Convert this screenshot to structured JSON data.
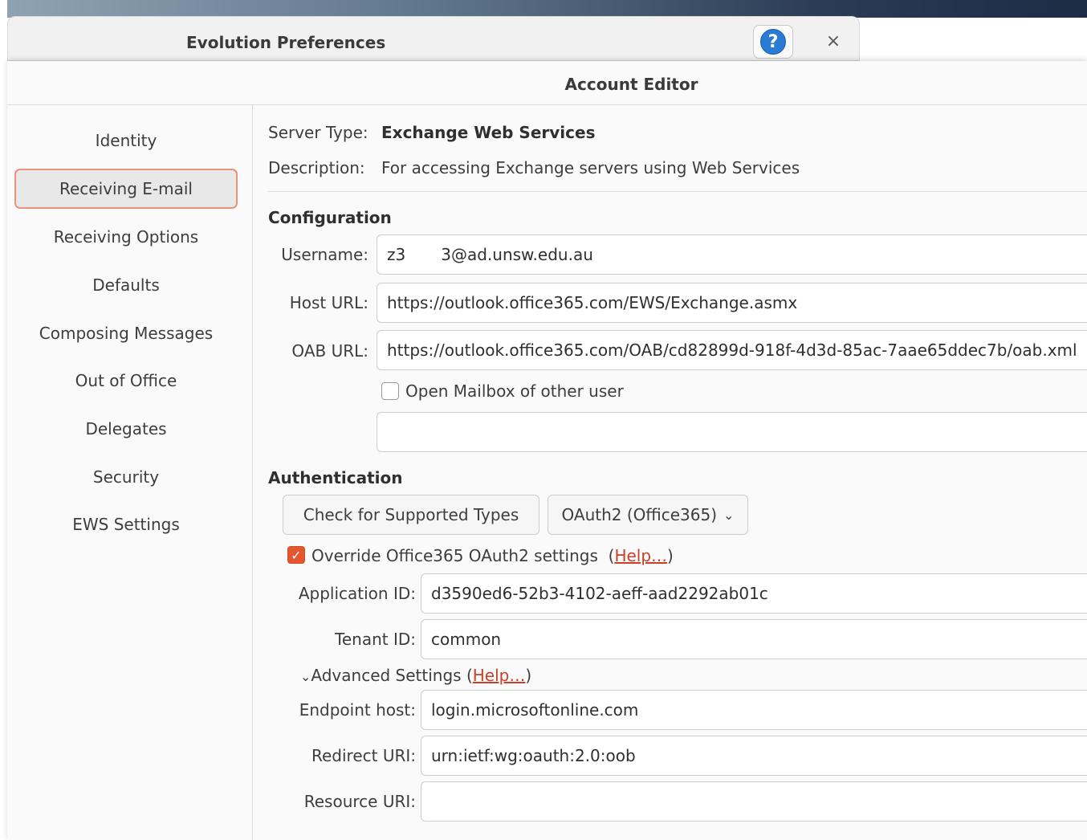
{
  "prefs_window": {
    "title": "Evolution Preferences",
    "help_icon": "question-mark-icon",
    "close_glyph": "×"
  },
  "dialog": {
    "title": "Account Editor"
  },
  "sidebar": {
    "items": [
      {
        "label": "Identity"
      },
      {
        "label": "Receiving E-mail",
        "selected": true
      },
      {
        "label": "Receiving Options"
      },
      {
        "label": "Defaults"
      },
      {
        "label": "Composing Messages"
      },
      {
        "label": "Out of Office"
      },
      {
        "label": "Delegates"
      },
      {
        "label": "Security"
      },
      {
        "label": "EWS Settings"
      }
    ]
  },
  "server": {
    "type_label": "Server Type:",
    "type_value": "Exchange Web Services",
    "desc_label": "Description:",
    "desc_value": "For accessing Exchange servers using Web Services"
  },
  "configuration": {
    "heading": "Configuration",
    "username_label": "Username:",
    "username_prefix": "z3",
    "username_suffix": "3@ad.unsw.edu.au",
    "host_label": "Host URL:",
    "host_value": "https://outlook.office365.com/EWS/Exchange.asmx",
    "oab_label": "OAB URL:",
    "oab_value": "https://outlook.office365.com/OAB/cd82899d-918f-4d3d-85ac-7aae65ddec7b/oab.xml",
    "open_mailbox_label": "Open Mailbox of other user",
    "open_mailbox_checked": false,
    "other_user_value": ""
  },
  "authentication": {
    "heading": "Authentication",
    "check_button": "Check for Supported Types",
    "method_value": "OAuth2 (Office365)",
    "override_label": "Override Office365 OAuth2 settings",
    "override_checked": true,
    "help_open": "(",
    "help_link": "Help…",
    "help_close": ")",
    "app_id_label": "Application ID:",
    "app_id_value": "d3590ed6-52b3-4102-aeff-aad2292ab01c",
    "tenant_label": "Tenant ID:",
    "tenant_value": "common",
    "advanced_label": "Advanced Settings",
    "endpoint_label": "Endpoint host:",
    "endpoint_value": "login.microsoftonline.com",
    "redirect_label": "Redirect URI:",
    "redirect_value": "urn:ietf:wg:oauth:2.0:oob",
    "resource_label": "Resource URI:",
    "resource_value": ""
  },
  "colors": {
    "accent": "#e4572e",
    "selection_border": "#e8927c",
    "link": "#c7402a",
    "help_blue": "#2a7bd4"
  }
}
